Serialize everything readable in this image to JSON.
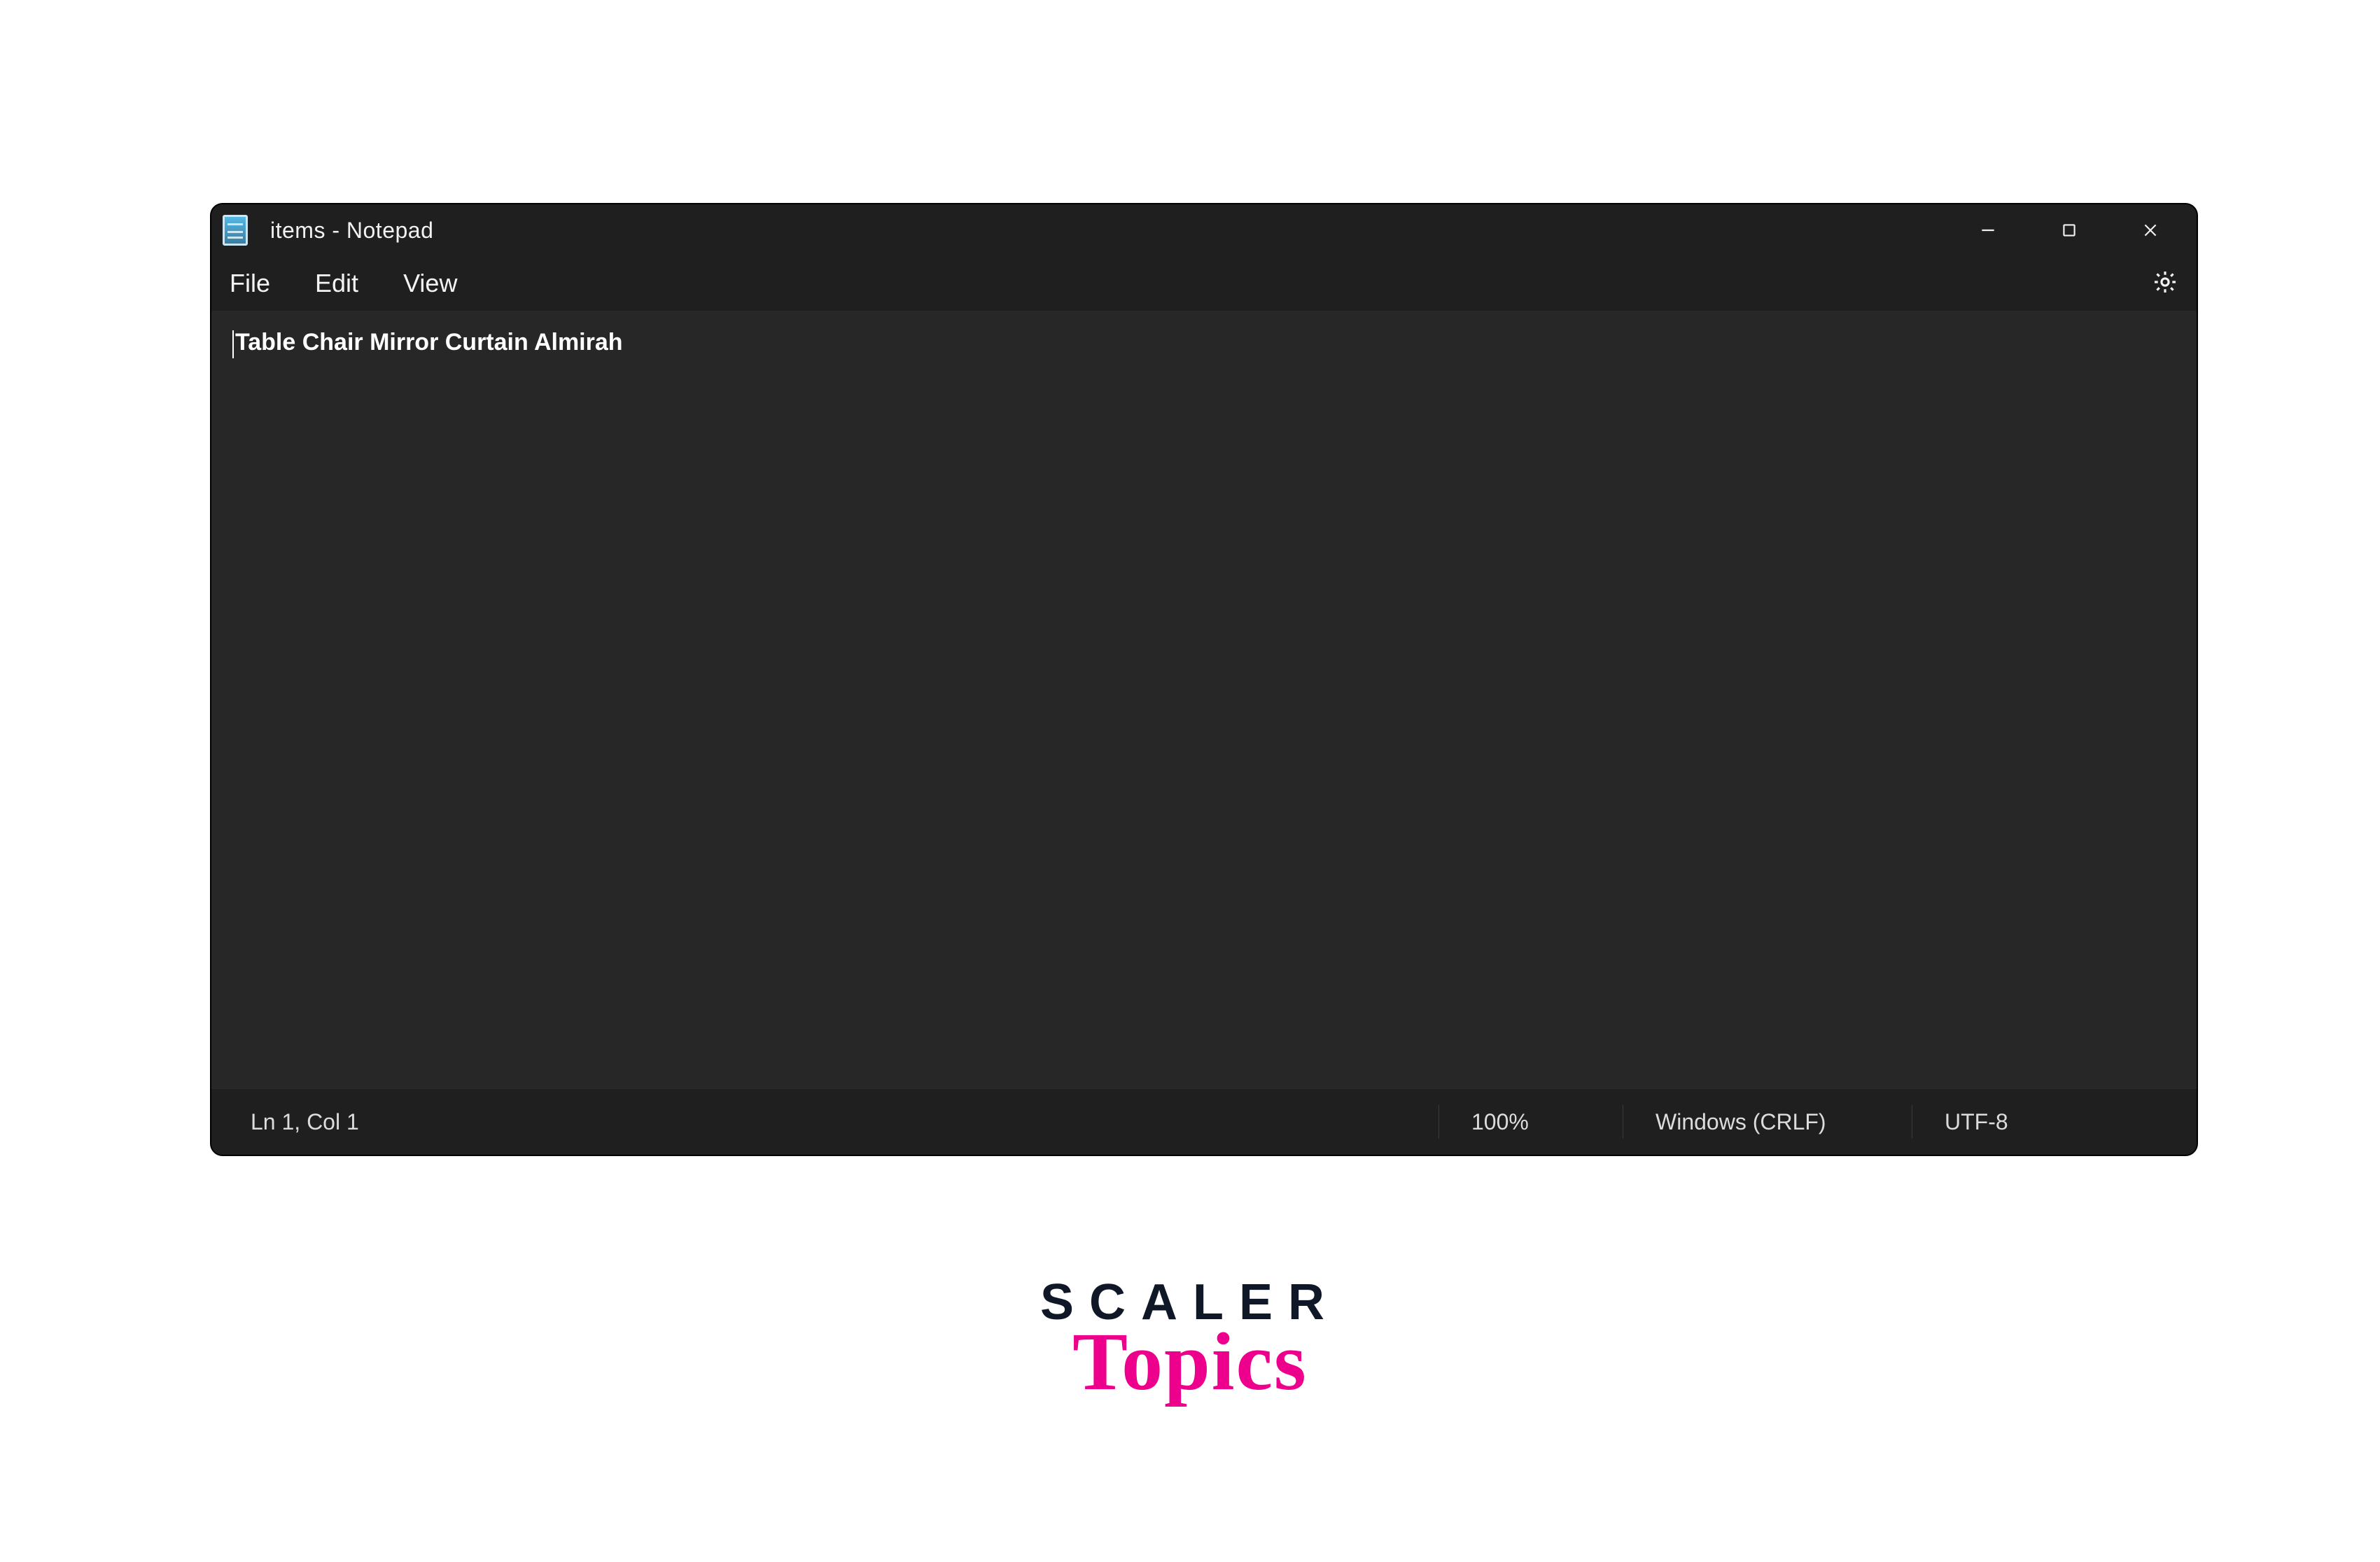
{
  "window": {
    "title": "items - Notepad",
    "controls": {
      "minimize": "Minimize",
      "maximize": "Maximize",
      "close": "Close"
    }
  },
  "menu": {
    "file": "File",
    "edit": "Edit",
    "view": "View",
    "settings": "Settings"
  },
  "editor": {
    "content": "Table Chair Mirror Curtain Almirah"
  },
  "status": {
    "position": "Ln 1, Col 1",
    "zoom": "100%",
    "line_ending": "Windows (CRLF)",
    "encoding": "UTF-8"
  },
  "branding": {
    "top": "SCALER",
    "bottom": "Topics"
  }
}
